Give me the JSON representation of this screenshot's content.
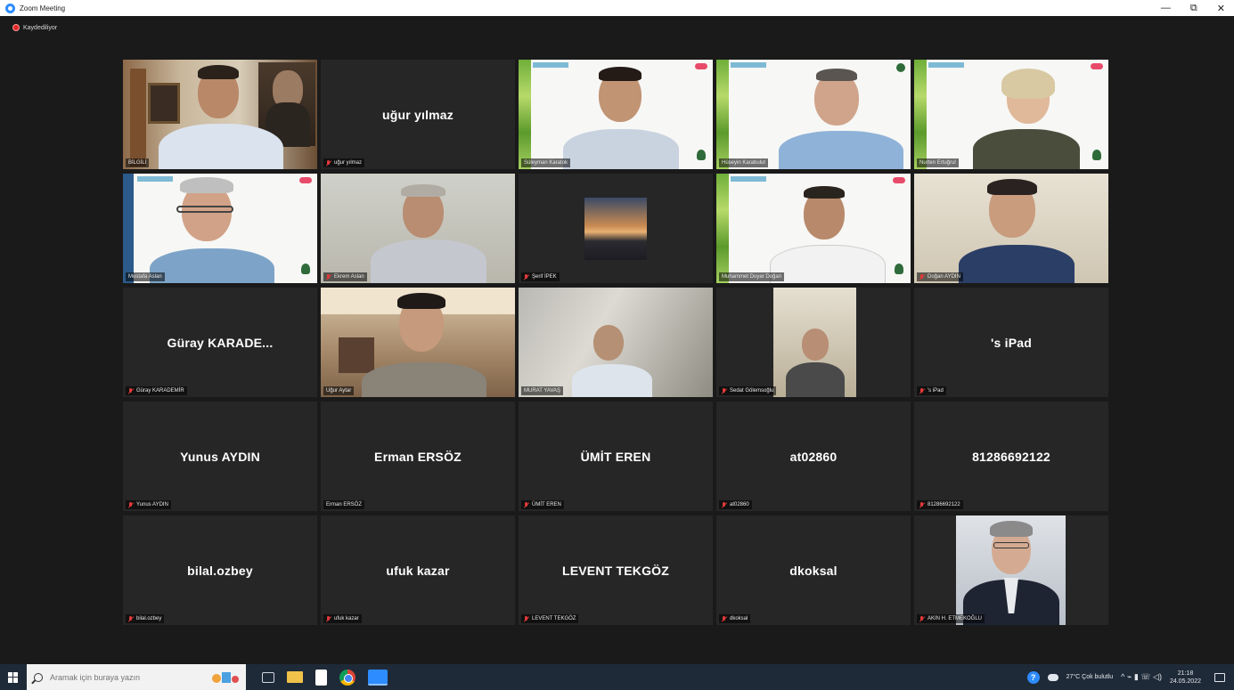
{
  "window": {
    "title": "Zoom Meeting",
    "minimize": "—",
    "restore": "⧉",
    "close": "✕"
  },
  "recording": {
    "label": "Kaydediliyor"
  },
  "colors": {
    "active_speaker": "#c8e64a",
    "tile_bg": "#262626",
    "mic_muted": "#e23a3a",
    "meeting_bg": "#1a1a1a"
  },
  "participants": [
    {
      "display": "",
      "nameplate": "BİLGİLİ",
      "video": true,
      "active": true
    },
    {
      "display": "uğur yılmaz",
      "nameplate": "uğur yılmaz",
      "video": false
    },
    {
      "display": "",
      "nameplate": "Süleyman Karatok",
      "video": true
    },
    {
      "display": "",
      "nameplate": "Hüseyin Karabulut",
      "video": true
    },
    {
      "display": "",
      "nameplate": "Nurten Ertuğrul",
      "video": true
    },
    {
      "display": "",
      "nameplate": "Mustafa Aslan",
      "video": true
    },
    {
      "display": "",
      "nameplate": "Ekrem Aslan",
      "video": true
    },
    {
      "display": "",
      "nameplate": "Şerif İPEK",
      "video": true
    },
    {
      "display": "",
      "nameplate": "Muhammet Duyar Doğan",
      "video": true
    },
    {
      "display": "",
      "nameplate": "Doğan AYDIN",
      "video": true
    },
    {
      "display": "Güray  KARADE...",
      "nameplate": "Güray KARADEMİR",
      "video": false
    },
    {
      "display": "",
      "nameplate": "Uğur Aytar",
      "video": true
    },
    {
      "display": "",
      "nameplate": "MURAT YAVAŞ",
      "video": true
    },
    {
      "display": "",
      "nameplate": "Sedat Gölemsoğlu",
      "video": true
    },
    {
      "display": "'s iPad",
      "nameplate": "'s iPad",
      "video": false
    },
    {
      "display": "Yunus AYDIN",
      "nameplate": "Yunus AYDIN",
      "video": false
    },
    {
      "display": "Erman ERSÖZ",
      "nameplate": "Erman ERSÖZ",
      "video": false
    },
    {
      "display": "ÜMİT EREN",
      "nameplate": "ÜMİT EREN",
      "video": false
    },
    {
      "display": "at02860",
      "nameplate": "at02860",
      "video": false
    },
    {
      "display": "81286692122",
      "nameplate": "81286692122",
      "video": false
    },
    {
      "display": "bilal.ozbey",
      "nameplate": "bilal.ozbey",
      "video": false
    },
    {
      "display": "ufuk kazar",
      "nameplate": "ufuk kazar",
      "video": false
    },
    {
      "display": "LEVENT TEKGÖZ",
      "nameplate": "LEVENT TEKGÖZ",
      "video": false
    },
    {
      "display": "dkoksal",
      "nameplate": "dkoksal",
      "video": false
    },
    {
      "display": "",
      "nameplate": "AKIN H. ETMEKOĞLU",
      "video": true
    }
  ],
  "taskbar": {
    "search_placeholder": "Aramak için buraya yazın",
    "weather": "27°C  Çok bulutlu",
    "time": "21:18",
    "date": "24.05.2022",
    "help": "?",
    "tray_symbols": "^  ⌁  ▮  ☏  ◁)"
  }
}
